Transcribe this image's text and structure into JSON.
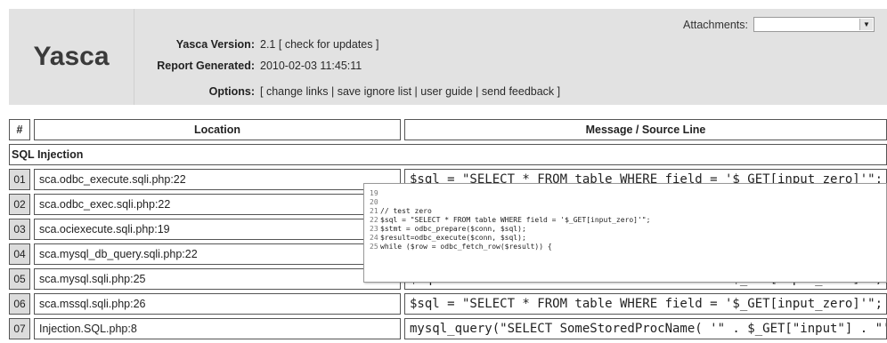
{
  "header": {
    "brand": "Yasca",
    "attachments_label": "Attachments:",
    "attachments_selected": "",
    "version_label": "Yasca Version:",
    "version_value": "2.1",
    "check_updates": "[ check for updates ]",
    "generated_label": "Report Generated:",
    "generated_value": "2010-02-03 11:45:11",
    "options_label": "Options:",
    "options_open": "[",
    "options_links": [
      "change links",
      "save ignore list",
      "user guide",
      "send feedback"
    ],
    "options_sep": "|",
    "options_close": "]"
  },
  "table": {
    "col_num": "#",
    "col_location": "Location",
    "col_message": "Message / Source Line",
    "section": "SQL Injection",
    "rows": [
      {
        "num": "01",
        "location": "sca.odbc_execute.sqli.php:22",
        "message": "$sql = \"SELECT * FROM table WHERE field = '$_GET[input_zero]'\";"
      },
      {
        "num": "02",
        "location": "sca.odbc_exec.sqli.php:22",
        "message": "$sql = \"SELECT * FROM table WHERE field = '$_GET[input_zero]'\";"
      },
      {
        "num": "03",
        "location": "sca.ociexecute.sqli.php:19",
        "message": "$sql = \"SELECT * FROM table WHERE field = '$_GET[input_zero]'\";"
      },
      {
        "num": "04",
        "location": "sca.mysql_db_query.sqli.php:22",
        "message": "$sql = \"SELECT * FROM table WHERE field = '$_GET[input_zero]'\";"
      },
      {
        "num": "05",
        "location": "sca.mysql.sqli.php:25",
        "message": "$sql = \"SELECT * FROM table WHERE field = '$_GET[input_zero]'\";"
      },
      {
        "num": "06",
        "location": "sca.mssql.sqli.php:26",
        "message": "$sql = \"SELECT * FROM table WHERE field = '$_GET[input_zero]'\";"
      },
      {
        "num": "07",
        "location": "Injection.SQL.php:8",
        "message": "mysql_query(\"SELECT SomeStoredProcName( '\" . $_GET[\"input\"] . \"' )\");"
      }
    ]
  },
  "tooltip": {
    "lines": [
      {
        "ln": "19",
        "code": ""
      },
      {
        "ln": "20",
        "code": ""
      },
      {
        "ln": "21",
        "code": "// test zero"
      },
      {
        "ln": "22",
        "code": "$sql = \"SELECT * FROM table WHERE field = '$_GET[input_zero]'\";"
      },
      {
        "ln": "23",
        "code": "$stmt = odbc_prepare($conn, $sql);"
      },
      {
        "ln": "24",
        "code": "$result=odbc_execute($conn, $sql);"
      },
      {
        "ln": "25",
        "code": "while ($row = odbc_fetch_row($result)) {"
      }
    ]
  }
}
